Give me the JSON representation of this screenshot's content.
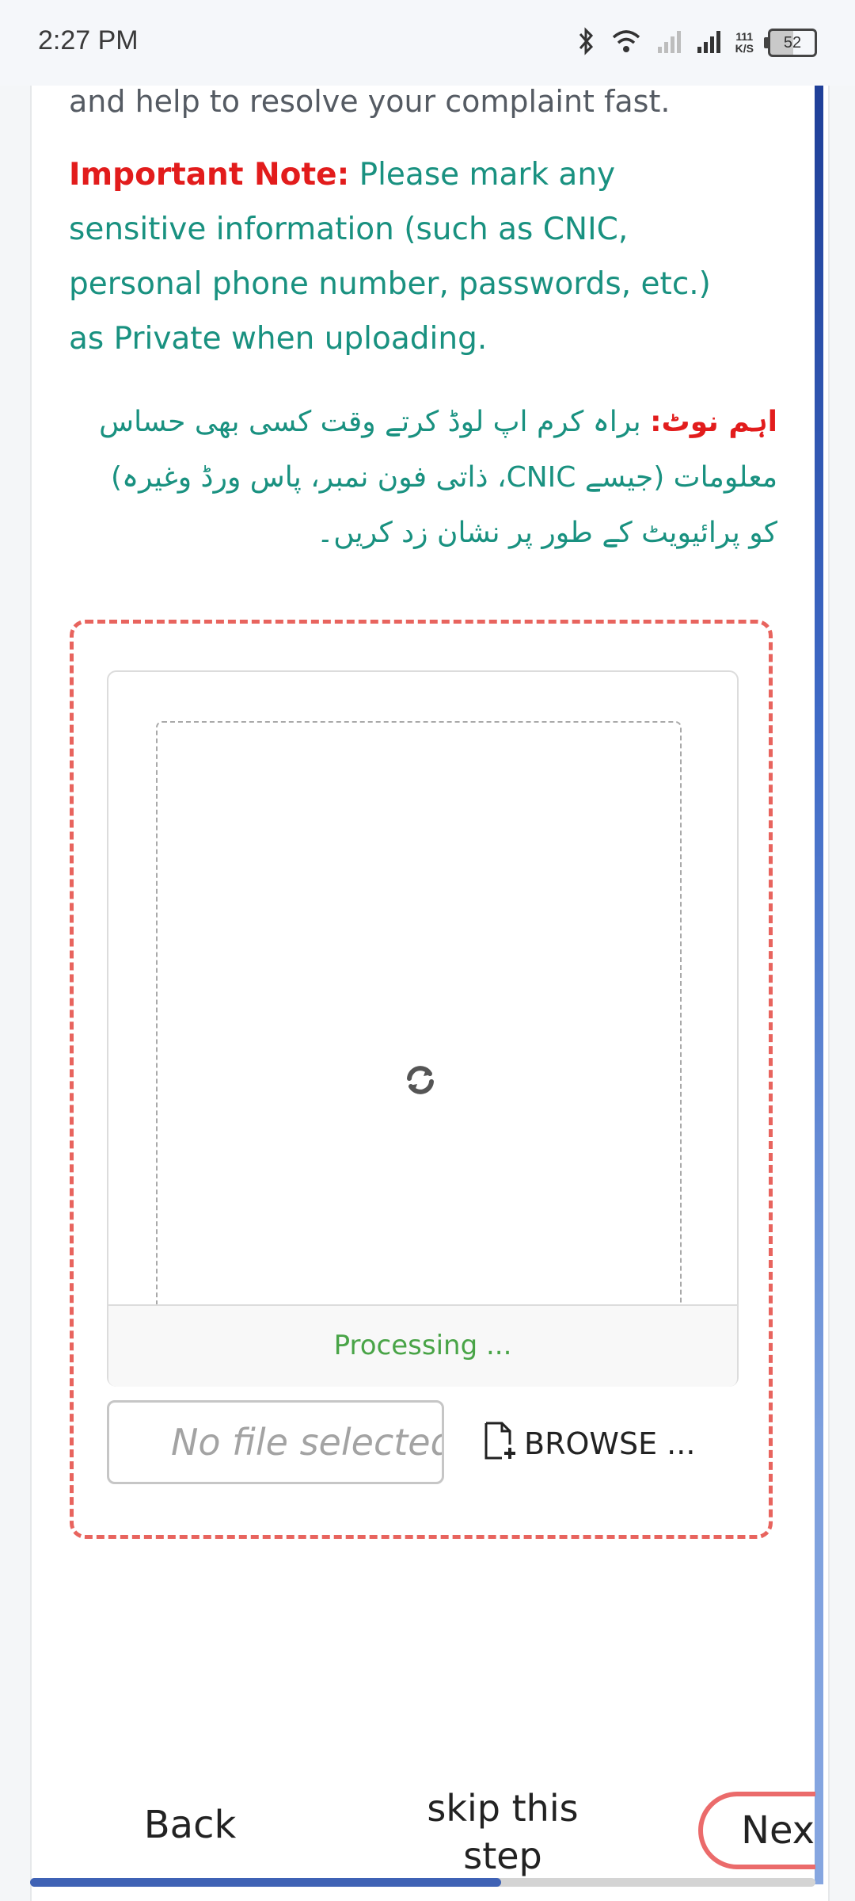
{
  "status_bar": {
    "time": "2:27 PM",
    "speed_value": "111",
    "speed_unit": "K/S",
    "battery": "52",
    "icons": [
      "bluetooth-icon",
      "wifi-icon",
      "signal-icon-1",
      "signal-icon-2"
    ]
  },
  "content": {
    "intro_text": "and help to resolve your complaint fast.",
    "note_label": "Important Note:",
    "note_text": " Please mark any sensitive information (such as CNIC, personal phone number, passwords, etc.) as Private when uploading.",
    "urdu_label": "اہم نوٹ:",
    "urdu_text": " براہ کرم اپ لوڈ کرتے وقت کسی بھی حساس معلومات (جیسے CNIC، ذاتی فون نمبر، پاس ورڈ وغیرہ) کو پرائیویٹ کے طور پر نشان زد کریں۔"
  },
  "upload": {
    "processing_text": "Processing ...",
    "file_placeholder": "No file selected",
    "browse_label": "BROWSE ...",
    "icons": [
      "refresh-icon",
      "file-add-icon"
    ]
  },
  "footer": {
    "back_label": "Back",
    "skip_label": "skip this step",
    "next_label": "Next",
    "progress_fraction": 0.6
  },
  "colors": {
    "accent_red": "#e21c1c",
    "note_teal": "#199180",
    "dropzone_border": "#e8645e",
    "processing_green": "#49a447",
    "progress_blue": "#3f62b5"
  }
}
